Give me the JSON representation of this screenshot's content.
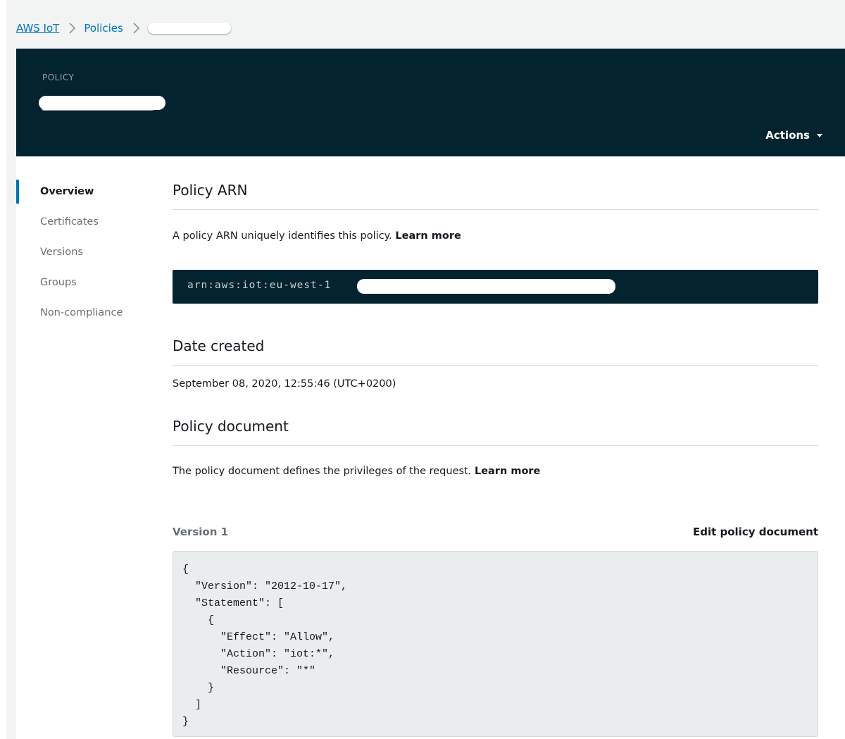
{
  "breadcrumb": {
    "root": "AWS IoT",
    "section": "Policies"
  },
  "header": {
    "label": "POLICY",
    "actions_label": "Actions"
  },
  "sidenav": {
    "items": [
      {
        "label": "Overview",
        "active": true
      },
      {
        "label": "Certificates",
        "active": false
      },
      {
        "label": "Versions",
        "active": false
      },
      {
        "label": "Groups",
        "active": false
      },
      {
        "label": "Non-compliance",
        "active": false
      }
    ]
  },
  "policy_arn": {
    "title": "Policy ARN",
    "description": "A policy ARN uniquely identifies this policy.",
    "learn_more": "Learn more",
    "arn_prefix": "arn:aws:iot:eu-west-1"
  },
  "date_created": {
    "title": "Date created",
    "value": "September 08, 2020, 12:55:46 (UTC+0200)"
  },
  "policy_document": {
    "title": "Policy document",
    "description": "The policy document defines the privileges of the request.",
    "learn_more": "Learn more",
    "version_label": "Version 1",
    "edit_label": "Edit policy document",
    "code": "{\n  \"Version\": \"2012-10-17\",\n  \"Statement\": [\n    {\n      \"Effect\": \"Allow\",\n      \"Action\": \"iot:*\",\n      \"Resource\": \"*\"\n    }\n  ]\n}"
  },
  "colors": {
    "header_bg": "#03232e",
    "link": "#0073bb",
    "active_indicator": "#0073bb",
    "page_bg": "#f2f3f3",
    "code_bg": "#eaeded"
  }
}
